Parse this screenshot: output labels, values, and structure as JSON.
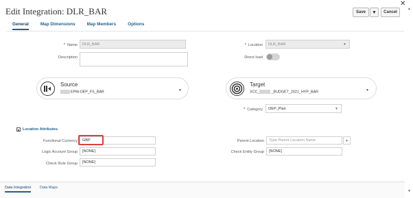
{
  "window": {
    "title": "Edit Integration: DLR_BAR"
  },
  "toolbar": {
    "save_label": "Save",
    "caret": "▼",
    "cancel_label": "Cancel",
    "close": "✕"
  },
  "tabs": [
    {
      "label": "General",
      "active": true
    },
    {
      "label": "Map Dimensions",
      "active": false
    },
    {
      "label": "Map Members",
      "active": false
    },
    {
      "label": "Options",
      "active": false
    }
  ],
  "general": {
    "name": {
      "label": "Name",
      "value": "DLR_BAR",
      "required": "*"
    },
    "description": {
      "label": "Description",
      "value": ""
    },
    "location": {
      "label": "Location",
      "value": "DLR_BAR",
      "required": "*"
    },
    "direct_load": {
      "label": "Direct load",
      "state": "off"
    }
  },
  "source": {
    "title": "Source",
    "value": "EPM-OEP_FS_BAR"
  },
  "target": {
    "title": "Target",
    "value_prefix": "XCC_",
    "value_suffix": "_BUDGET_2021_HYP_BAR"
  },
  "category": {
    "label": "Category",
    "value": "OEP_Plan",
    "required": "*"
  },
  "location_attributes": {
    "heading": "Location Attributes",
    "functional_currency": {
      "label": "Functional Currency",
      "value": "GBP"
    },
    "logic_account_group": {
      "label": "Logic Account Group",
      "value": "[NONE]"
    },
    "check_rule_group": {
      "label": "Check Rule Group",
      "value": "[NONE]"
    },
    "parent_location": {
      "label": "Parent Location",
      "placeholder": "Type Parent Location Name"
    },
    "check_entity_group": {
      "label": "Check Entity Group",
      "value": "[NONE]"
    }
  },
  "footer": {
    "tabs": [
      {
        "label": "Data Integration",
        "active": true
      },
      {
        "label": "Data Maps",
        "active": false
      }
    ]
  },
  "colors": {
    "accent": "#1f5f8f",
    "highlight": "#d9403e"
  },
  "icons": {
    "source": "source-icon",
    "target": "target-icon",
    "close": "close-icon"
  }
}
